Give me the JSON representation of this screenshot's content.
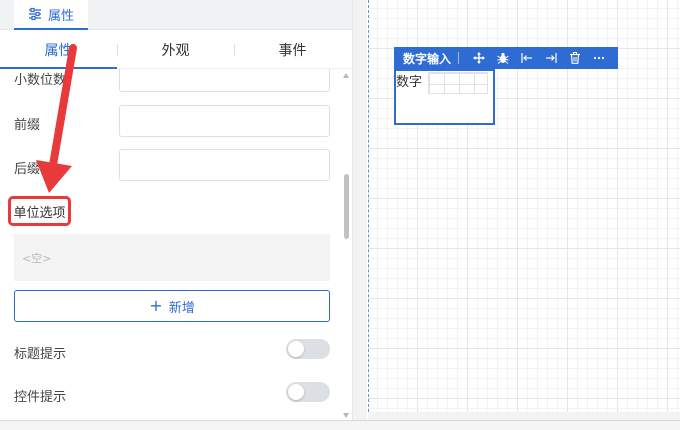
{
  "panel_tab": {
    "label": "属性",
    "icon": "sliders-icon"
  },
  "sub_tabs": [
    {
      "label": "属性",
      "active": true
    },
    {
      "label": "外观",
      "active": false
    },
    {
      "label": "事件",
      "active": false
    }
  ],
  "fields": {
    "decimal_places": {
      "label": "小数位数",
      "value": ""
    },
    "prefix": {
      "label": "前缀",
      "value": ""
    },
    "suffix": {
      "label": "后缀",
      "value": ""
    }
  },
  "unit_options": {
    "label": "单位选项",
    "empty_text": "<空>",
    "add_label": "新增",
    "add_icon": "plus-icon"
  },
  "toggles": [
    {
      "label": "标题提示",
      "on": false
    },
    {
      "label": "控件提示",
      "on": false
    }
  ],
  "widget_toolbar": {
    "title": "数字输入",
    "icons": [
      "move-icon",
      "bug-icon",
      "align-left-icon",
      "align-right-icon",
      "delete-icon",
      "more-icon"
    ]
  },
  "widget": {
    "label": "数字"
  },
  "colors": {
    "accent": "#2e6bd3",
    "highlight": "#e83a3a"
  }
}
